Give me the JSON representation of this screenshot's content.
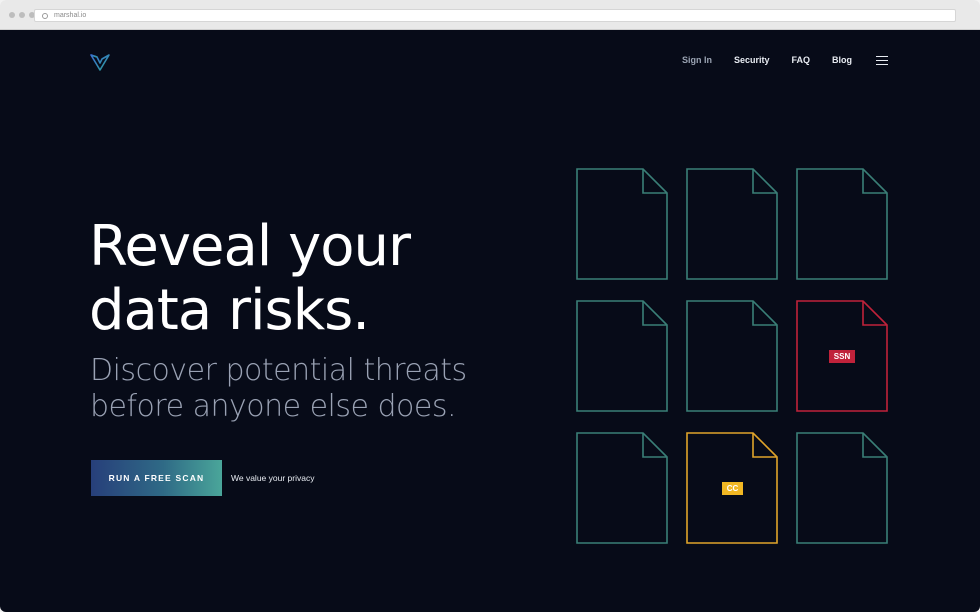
{
  "browser": {
    "url": "marshal.io"
  },
  "nav": {
    "sign_in": "Sign In",
    "security": "Security",
    "faq": "FAQ",
    "blog": "Blog",
    "menu_icon": "hamburger-menu-icon"
  },
  "hero": {
    "headline_line1": "Reveal your",
    "headline_line2": "data risks.",
    "subhead_line1": "Discover potential threats",
    "subhead_line2": "before anyone else does.",
    "cta_label": "RUN A FREE SCAN",
    "privacy_link": "We value your privacy"
  },
  "documents": {
    "items": [
      {
        "status": "clean"
      },
      {
        "status": "clean"
      },
      {
        "status": "clean"
      },
      {
        "status": "clean"
      },
      {
        "status": "clean"
      },
      {
        "status": "risk",
        "badge": "SSN"
      },
      {
        "status": "clean"
      },
      {
        "status": "warning",
        "badge": "CC"
      },
      {
        "status": "clean"
      }
    ],
    "ssn_badge": "SSN",
    "cc_badge": "CC"
  },
  "colors": {
    "background": "#070b18",
    "doc_clean": "#3a7f77",
    "doc_risk": "#c0223a",
    "doc_warning": "#e0a42a",
    "cta_gradient_start": "#273f7a",
    "cta_gradient_end": "#4aa69a"
  }
}
